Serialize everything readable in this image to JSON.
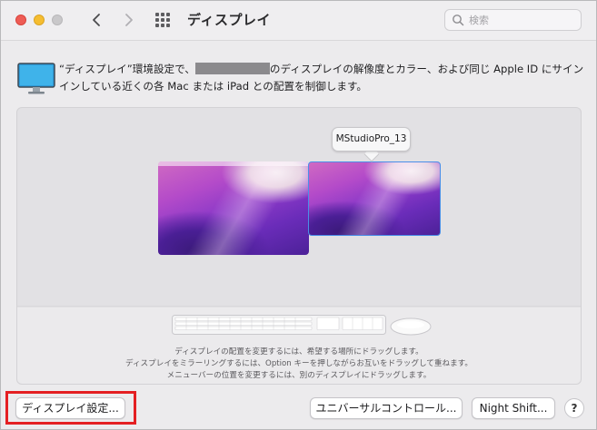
{
  "window": {
    "title": "ディスプレイ"
  },
  "search": {
    "placeholder": "検索"
  },
  "description": {
    "part1": "“ディスプレイ”環境設定で、",
    "part2": "のディスプレイの解像度とカラー、および同じ Apple ID にサインインしている近くの各 Mac または iPad との配置を制御します。"
  },
  "arrangement": {
    "tooltip": "MStudioPro_13",
    "hint_lines": [
      "ディスプレイの配置を変更するには、希望する場所にドラッグします。",
      "ディスプレイをミラーリングするには、Option キーを押しながらお互いをドラッグして重ねます。",
      "メニューバーの位置を変更するには、別のディスプレイにドラッグします。"
    ]
  },
  "buttons": {
    "display_settings": "ディスプレイ設定...",
    "universal_control": "ユニバーサルコントロール...",
    "night_shift": "Night Shift...",
    "help": "?"
  },
  "icons": {
    "close": "close-icon",
    "minimize": "minimize-icon",
    "zoom": "zoom-icon",
    "back": "chevron-left-icon",
    "forward": "chevron-right-icon",
    "grid": "grid-icon",
    "search": "search-icon",
    "monitor": "monitor-icon",
    "keyboard": "keyboard-icon",
    "mouse": "mouse-icon"
  },
  "colors": {
    "highlight": "#e41f22",
    "close": "#ee5c55",
    "minimize": "#f5bd31"
  }
}
